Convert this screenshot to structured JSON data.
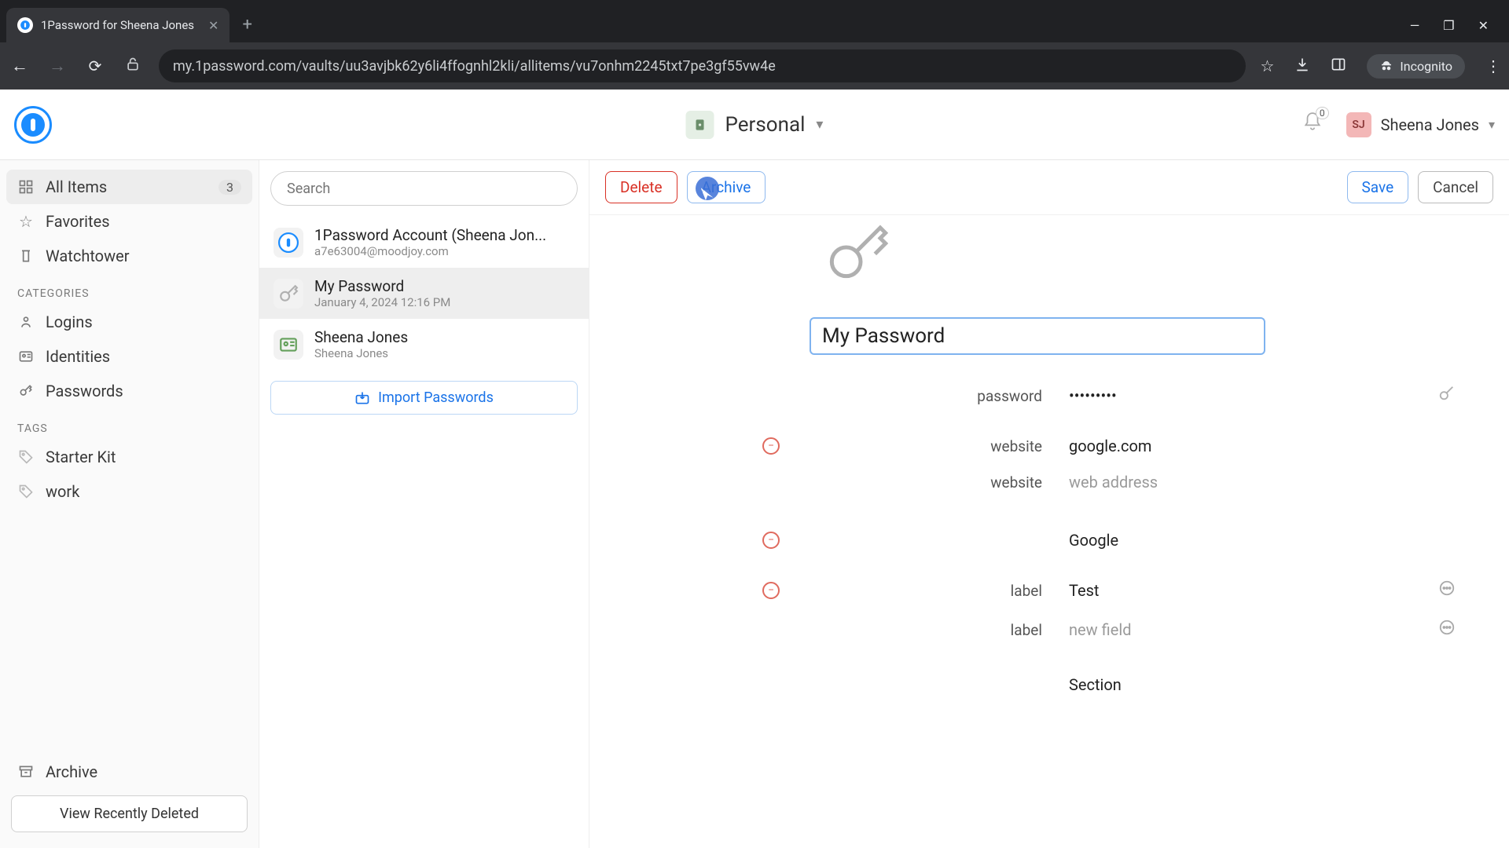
{
  "browser": {
    "tab_title": "1Password for Sheena Jones",
    "url": "my.1password.com/vaults/uu3avjbk62y6li4ffognhl2kli/allitems/vu7onhm2245txt7pe3gf55vw4e",
    "incognito_label": "Incognito"
  },
  "header": {
    "vault_name": "Personal",
    "notif_count": "0",
    "user_name": "Sheena Jones",
    "user_initials": "SJ"
  },
  "sidebar": {
    "all_items": "All Items",
    "all_items_count": "3",
    "favorites": "Favorites",
    "watchtower": "Watchtower",
    "categories_label": "CATEGORIES",
    "logins": "Logins",
    "identities": "Identities",
    "passwords": "Passwords",
    "tags_label": "TAGS",
    "tag_starter": "Starter Kit",
    "tag_work": "work",
    "archive": "Archive",
    "view_deleted": "View Recently Deleted"
  },
  "list": {
    "search_placeholder": "Search",
    "items": [
      {
        "title": "1Password Account (Sheena Jon...",
        "subtitle": "a7e63004@moodjoy.com"
      },
      {
        "title": "My Password",
        "subtitle": "January 4, 2024 12:16 PM"
      },
      {
        "title": "Sheena Jones",
        "subtitle": "Sheena Jones"
      }
    ],
    "import_label": "Import Passwords"
  },
  "detail": {
    "toolbar": {
      "delete": "Delete",
      "archive": "Archive",
      "save": "Save",
      "cancel": "Cancel"
    },
    "title_value": "My Password",
    "password_label": "password",
    "password_value": "•••••••••",
    "website_label": "website",
    "website_value": "google.com",
    "website2_label": "website",
    "website2_placeholder": "web address",
    "section_google": "Google",
    "label_label": "label",
    "label_value": "Test",
    "label2_label": "label",
    "label2_placeholder": "new field",
    "section_section": "Section"
  }
}
